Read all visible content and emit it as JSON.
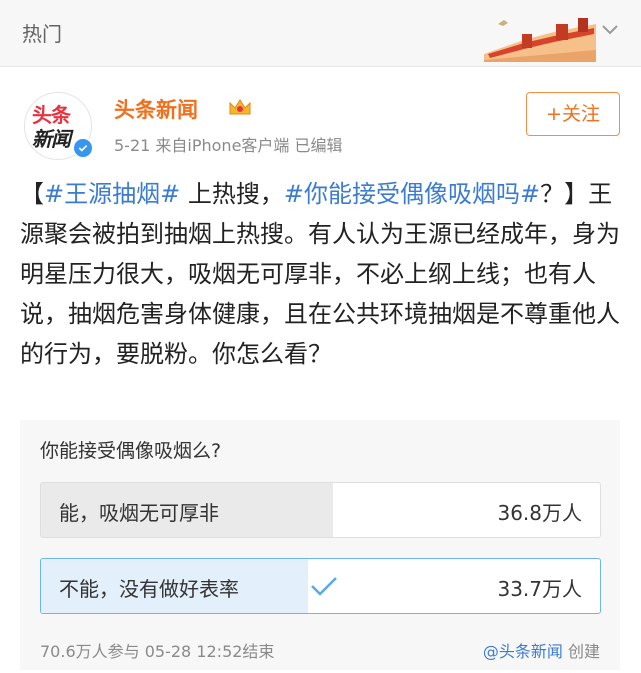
{
  "header": {
    "tab_label": "热门"
  },
  "post": {
    "author_name": "头条新闻",
    "avatar_line1": "头条",
    "avatar_line2": "新闻",
    "meta": "5-21  来自iPhone客户端  已编辑",
    "follow_label": "+关注",
    "text": {
      "open_bracket": "【",
      "tag1": "#王源抽烟#",
      "mid1": " 上热搜，",
      "tag2": "#你能接受偶像吸烟吗#",
      "rest": "？】王源聚会被拍到抽烟上热搜。有人认为王源已经成年，身为明星压力很大，吸烟无可厚非，不必上纲上线；也有人说，抽烟危害身体健康，且在公共环境抽烟是不尊重他人的行为，要脱粉。你怎么看？"
    }
  },
  "poll": {
    "question": "你能接受偶像吸烟么?",
    "options": [
      {
        "label": "能，吸烟无可厚非",
        "count": "36.8万人",
        "share": 0.522,
        "selected": false
      },
      {
        "label": "不能，没有做好表率",
        "count": "33.7万人",
        "share": 0.478,
        "selected": true
      }
    ],
    "participants": "70.6万人参与",
    "end_time": "05-28 12:52结束",
    "creator": "@头条新闻",
    "created_label": "创建"
  },
  "colors": {
    "accent_orange": "#f1701d",
    "link_blue": "#3b7bd1",
    "verified_blue": "#3797f0",
    "selected_border": "#6fb5ea"
  },
  "icons": [
    "great-wall-icon",
    "chevron-down-icon",
    "crown-icon",
    "verified-icon",
    "check-icon"
  ]
}
